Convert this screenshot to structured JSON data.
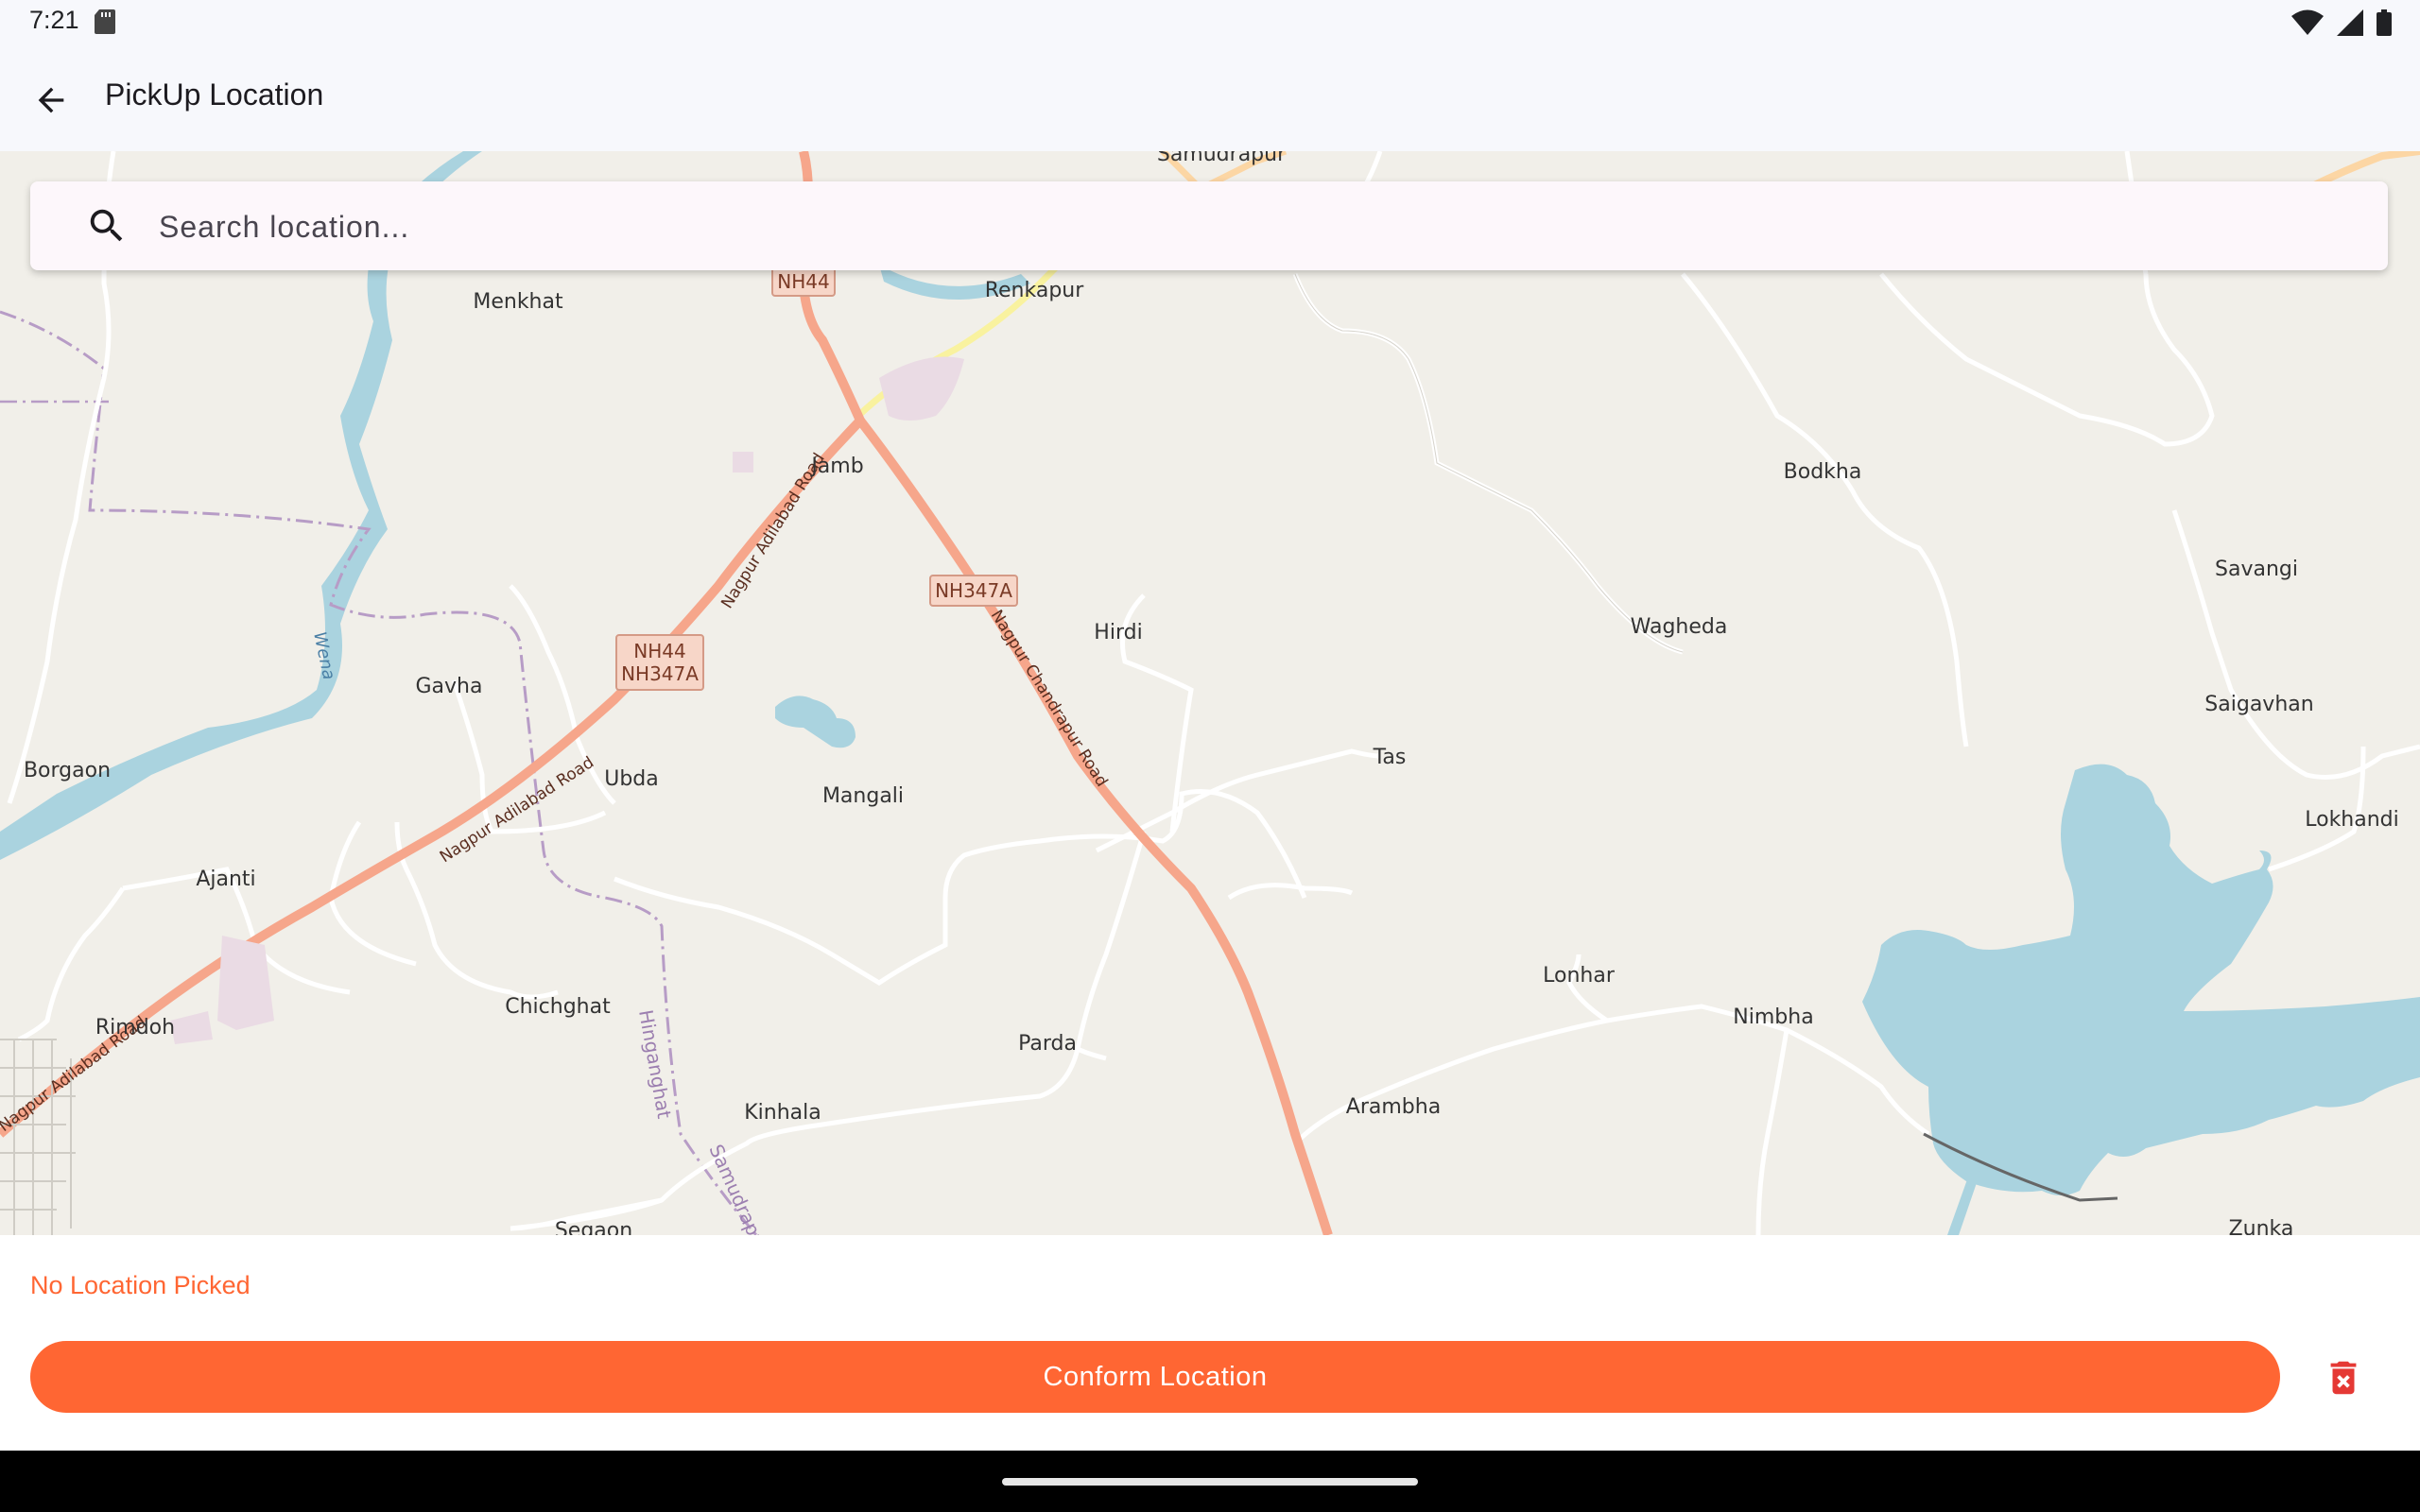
{
  "status_bar": {
    "time": "7:21",
    "icons": [
      "sd-card-icon",
      "wifi-icon",
      "signal-icon",
      "battery-icon"
    ]
  },
  "app_bar": {
    "title": "PickUp Location",
    "back_icon": "arrow-back-icon"
  },
  "search": {
    "placeholder": "Search location...",
    "value": "",
    "icon": "search-icon"
  },
  "map": {
    "place_labels": [
      "Samudrapur",
      "Renkapur",
      "Menkhat",
      "Jamb",
      "Bodkha",
      "Savangi",
      "Hirdi",
      "Wagheda",
      "Gavha",
      "Saigavhan",
      "Borgaon",
      "Ubda",
      "Tas",
      "Mangali",
      "Lokhandi",
      "Ajanti",
      "Lonhar",
      "Nimbha",
      "Rimdoh",
      "Chichghat",
      "Parda",
      "Arambha",
      "Kinhala",
      "Segaon",
      "Zunka"
    ],
    "road_labels": [
      "Nagpur Adilabad Road",
      "Nagpur Adilabad Road",
      "Nagpur Chandrapur Road",
      "Nagpur Adilabad Road"
    ],
    "shields": [
      "NH44",
      "NH347A",
      "NH44",
      "NH347A"
    ],
    "river_label": "Wena",
    "boundary_labels": [
      "Hinganghat",
      "Samudrapur"
    ],
    "colors": {
      "land": "#f1efe9",
      "water": "#aad3df",
      "highway": "#f6a68b",
      "trunk": "#f9f29f",
      "minor_road": "#ffffff",
      "boundary": "#b79cc6"
    }
  },
  "bottom": {
    "status_message": "No Location Picked",
    "confirm_label": "Conform Location",
    "delete_icon": "delete-forever-icon"
  },
  "theme": {
    "accent": "#ff6633",
    "background": "#f7f8fc"
  }
}
